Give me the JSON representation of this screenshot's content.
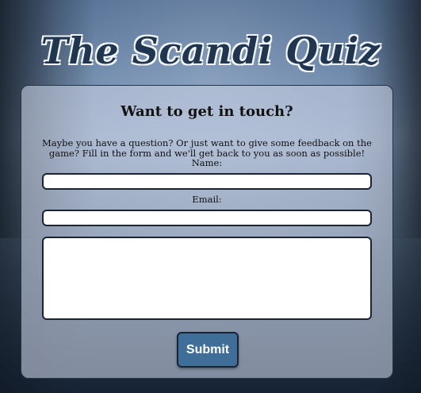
{
  "site": {
    "title": "The Scandi Quiz"
  },
  "contact": {
    "heading": "Want to get in touch?",
    "intro": "Maybe you have a question? Or just want to give some feedback on the game? Fill in the form and we'll get back to you as soon as possible!",
    "name_label": "Name:",
    "name_value": "",
    "email_label": "Email:",
    "email_value": "",
    "message_value": "",
    "submit_label": "Submit"
  },
  "colors": {
    "title_text": "#1f3550",
    "title_outline": "#f3f6fa",
    "card_border": "#233548",
    "button_bg": "#3f6e98",
    "field_border": "#1b2433"
  }
}
